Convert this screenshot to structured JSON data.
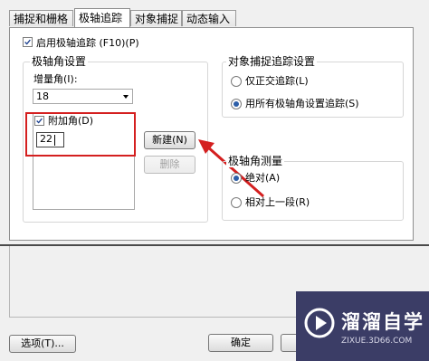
{
  "tabs": [
    {
      "label": "捕捉和栅格",
      "active": false
    },
    {
      "label": "极轴追踪",
      "active": true
    },
    {
      "label": "对象捕捉",
      "active": false
    },
    {
      "label": "动态输入",
      "active": false
    }
  ],
  "polar": {
    "enable_label": "启用极轴追踪 (F10)(P)",
    "enable_checked": true
  },
  "angle_settings": {
    "title": "极轴角设置",
    "increment_label": "增量角(I):",
    "increment_value": "18",
    "additional_label": "附加角(D)",
    "additional_checked": true,
    "additional_value": "22",
    "new_button": "新建(N)",
    "delete_button": "删除"
  },
  "snap_tracking": {
    "title": "对象捕捉追踪设置",
    "options": [
      {
        "label": "仅正交追踪(L)",
        "checked": false
      },
      {
        "label": "用所有极轴角设置追踪(S)",
        "checked": true
      }
    ]
  },
  "measurement": {
    "title": "极轴角测量",
    "options": [
      {
        "label": "绝对(A)",
        "checked": true
      },
      {
        "label": "相对上一段(R)",
        "checked": false
      }
    ]
  },
  "footer": {
    "options_button": "选项(T)...",
    "ok_button": "确定"
  },
  "watermark": {
    "title": "溜溜自学",
    "subtitle": "ZIXUE.3D66.COM"
  },
  "colors": {
    "highlight": "#d41f1f",
    "watermark_bg": "#3b3d66"
  }
}
